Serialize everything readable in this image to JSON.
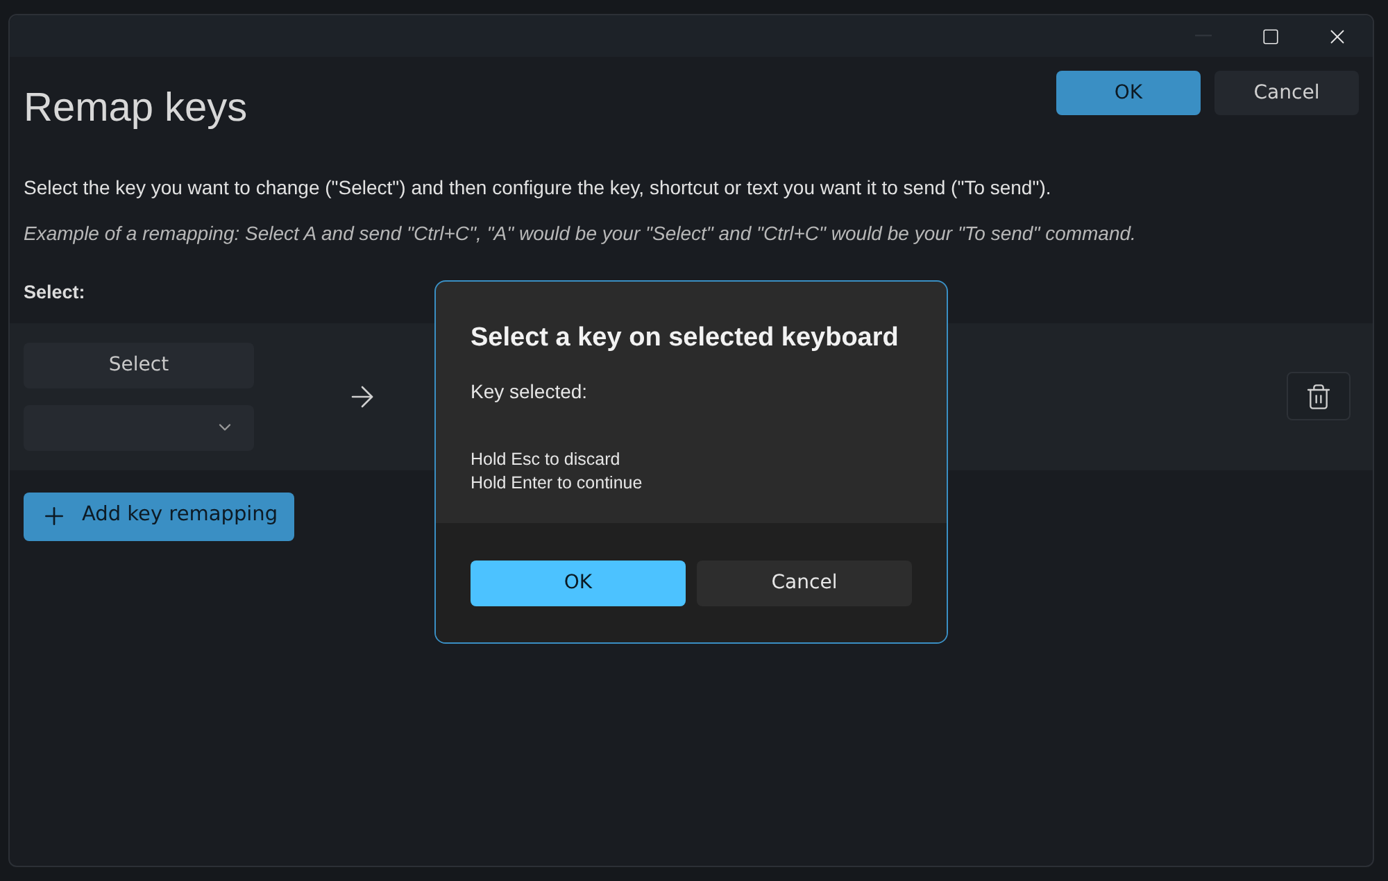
{
  "window": {
    "controls": [
      {
        "kind": "minimize",
        "disabled": true
      },
      {
        "kind": "maximize",
        "disabled": false
      },
      {
        "kind": "close",
        "disabled": false
      }
    ]
  },
  "header": {
    "title": "Remap keys",
    "ok": "OK",
    "cancel": "Cancel"
  },
  "description": "Select the key you want to change (\"Select\") and then configure the key, shortcut or text you want it to send (\"To send\").",
  "example": "Example of a remapping: Select A and send \"Ctrl+C\", \"A\" would be your \"Select\" and \"Ctrl+C\" would be your \"To send\" command.",
  "select_label": "Select:",
  "mapping_row": {
    "select_button": "Select"
  },
  "add_button": "Add key remapping",
  "dialog": {
    "title": "Select a key on selected keyboard",
    "key_selected": "Key selected:",
    "hints": [
      "Hold Esc to discard",
      "Hold Enter to continue"
    ],
    "ok": "OK",
    "cancel": "Cancel"
  }
}
